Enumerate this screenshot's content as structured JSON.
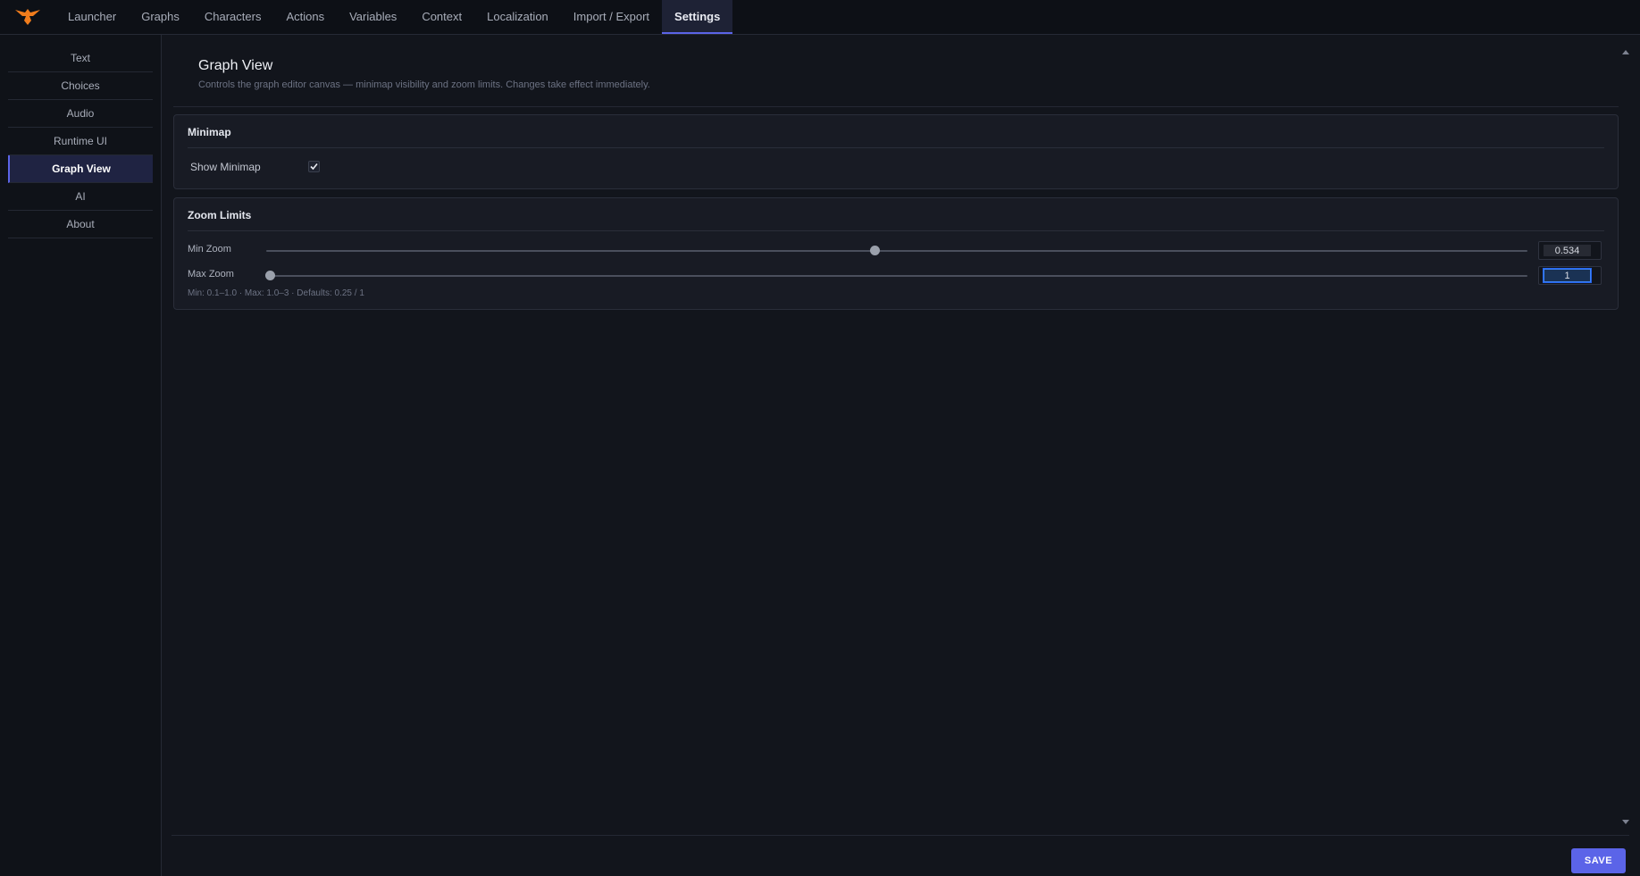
{
  "nav": {
    "logo_icon": "bird-logo-icon",
    "tabs": [
      {
        "label": "Launcher"
      },
      {
        "label": "Graphs"
      },
      {
        "label": "Characters"
      },
      {
        "label": "Actions"
      },
      {
        "label": "Variables"
      },
      {
        "label": "Context"
      },
      {
        "label": "Localization"
      },
      {
        "label": "Import / Export"
      },
      {
        "label": "Settings"
      }
    ],
    "active_tab": "Settings"
  },
  "sidebar": {
    "items": [
      {
        "label": "Text"
      },
      {
        "label": "Choices"
      },
      {
        "label": "Audio"
      },
      {
        "label": "Runtime UI"
      },
      {
        "label": "Graph View"
      },
      {
        "label": "AI"
      },
      {
        "label": "About"
      }
    ],
    "active_item": "Graph View"
  },
  "header": {
    "title": "Graph View",
    "description": "Controls the graph editor canvas — minimap visibility and zoom limits. Changes take effect immediately."
  },
  "minimap": {
    "title": "Minimap",
    "show_label": "Show Minimap",
    "show_checked": true
  },
  "zoom": {
    "title": "Zoom Limits",
    "min_label": "Min Zoom",
    "min_value": "0.534",
    "min_slider_fraction": 0.482,
    "max_label": "Max Zoom",
    "max_value": "1",
    "max_slider_fraction": 0.0,
    "hint": "Min: 0.1–1.0  ·  Max: 1.0–3  ·  Defaults: 0.25 / 1"
  },
  "footer": {
    "save_label": "SAVE"
  },
  "colors": {
    "accent": "#5b64e8",
    "background": "#12151c",
    "logo": "#f07c1c"
  }
}
